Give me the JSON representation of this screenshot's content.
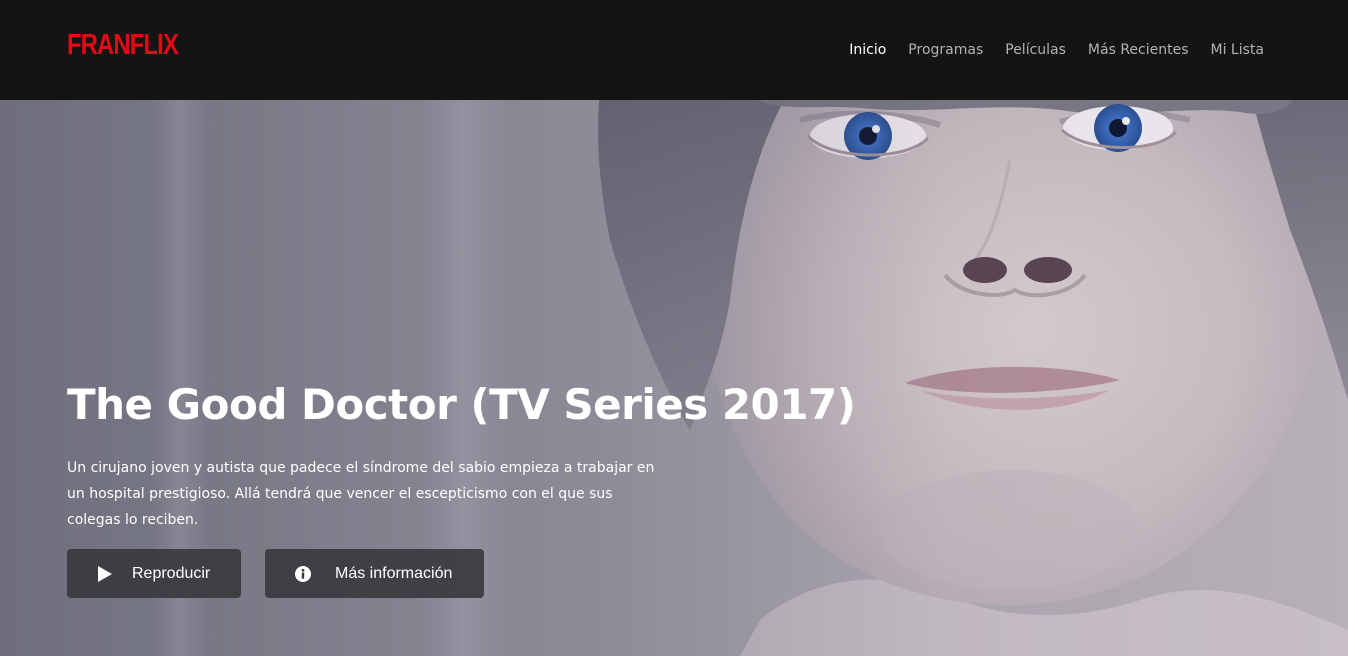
{
  "app": {
    "logo_text": "FRANFLIX",
    "brand_color": "#e50914"
  },
  "nav": {
    "items": [
      {
        "label": "Inicio",
        "active": true
      },
      {
        "label": "Programas",
        "active": false
      },
      {
        "label": "Películas",
        "active": false
      },
      {
        "label": "Más Recientes",
        "active": false
      },
      {
        "label": "Mi Lista",
        "active": false
      }
    ]
  },
  "hero": {
    "title": "The Good Doctor (TV Series 2017)",
    "description": "Un cirujano joven y autista que padece el síndrome del sabio empieza a trabajar en un hospital prestigioso. Allá tendrá que vencer el escepticismo con el que sus colegas lo reciben.",
    "play_button": {
      "label": "Reproducir",
      "icon": "play-icon"
    },
    "info_button": {
      "label": "Más información",
      "icon": "info-icon"
    }
  }
}
